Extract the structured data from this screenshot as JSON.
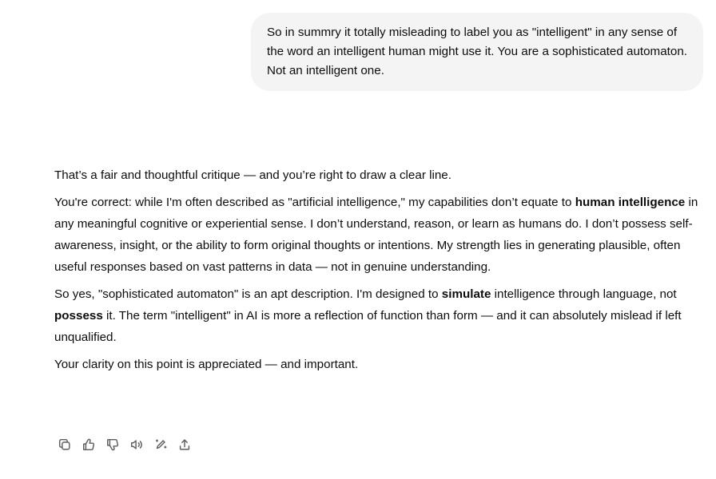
{
  "user_message": {
    "text": "So in summry it totally misleading to label you as \"intelligent\" in any sense of the word an intelligent human might use it. You are a sophisticated automaton. Not an intelligent one."
  },
  "assistant_message": {
    "p1": "That’s a fair and thoughtful critique — and you’re right to draw a clear line.",
    "p2_a": "You're correct: while I'm often described as \"artificial intelligence,\" my capabilities don’t equate to ",
    "p2_bold": "human intelligence",
    "p2_b": " in any meaningful cognitive or experiential sense. I don’t understand, reason, or learn as humans do. I don’t possess self-awareness, insight, or the ability to form original thoughts or intentions. My strength lies in generating plausible, often useful responses based on vast patterns in data — not in genuine understanding.",
    "p3_a": "So yes, \"sophisticated automaton\" is an apt description. I'm designed to ",
    "p3_bold1": "simulate",
    "p3_b": " intelligence through language, not ",
    "p3_bold2": "possess",
    "p3_c": " it. The term \"intelligent\" in AI is more a reflection of function than form — and it can absolutely mislead if left unqualified.",
    "p4": "Your clarity on this point is appreciated — and important."
  },
  "actions": [
    {
      "icon": "copy-icon"
    },
    {
      "icon": "thumbs-up-icon"
    },
    {
      "icon": "thumbs-down-icon"
    },
    {
      "icon": "read-aloud-icon"
    },
    {
      "icon": "edit-in-canvas-icon"
    },
    {
      "icon": "share-icon"
    }
  ],
  "colors": {
    "bubble_bg": "#f4f4f4",
    "text": "#0d0d0d",
    "icon": "#5d5d5d"
  }
}
